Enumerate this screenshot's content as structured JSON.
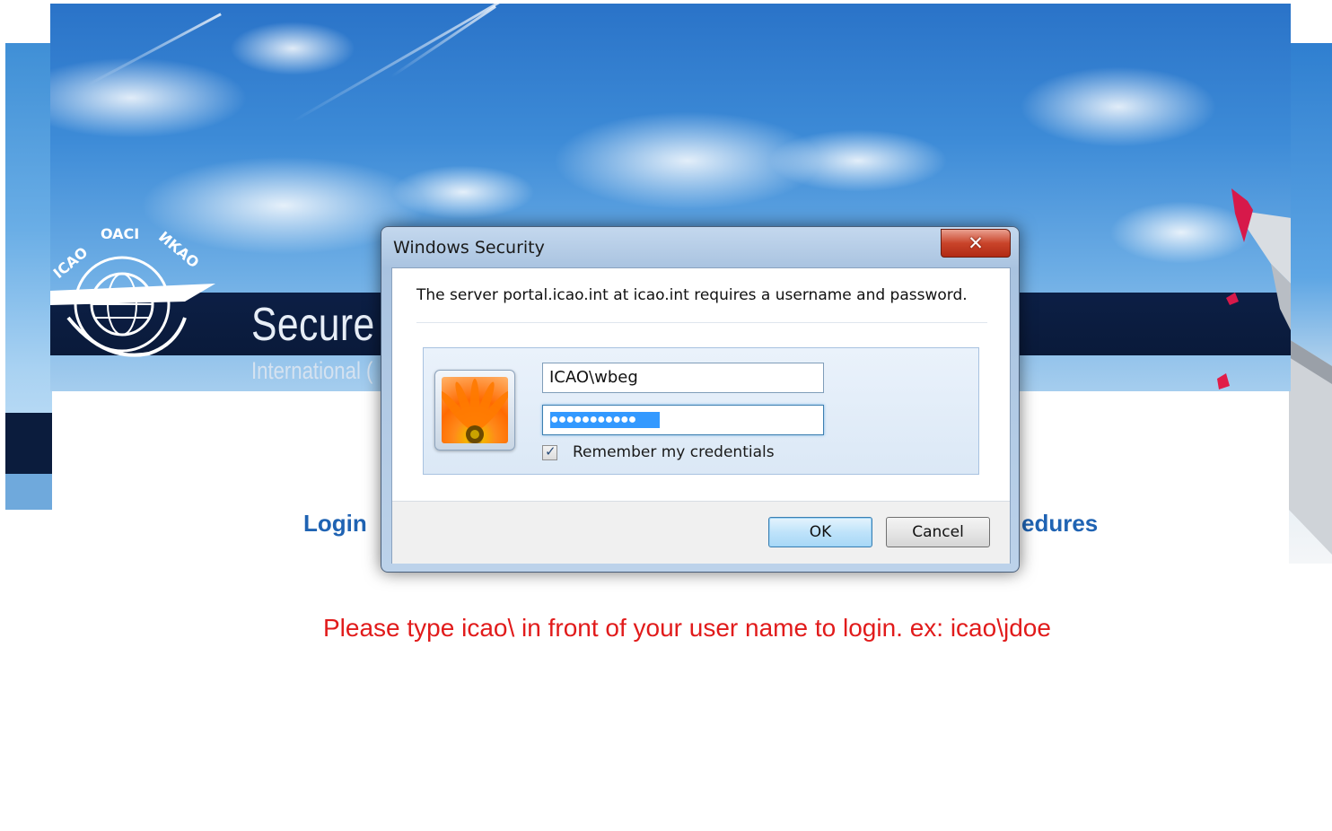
{
  "page": {
    "hero_title": "Secure",
    "hero_subtitle": "International (",
    "nav_login": "Login",
    "nav_procedures": "edures",
    "notice": "Please type icao\\ in front of your user name to login. ex: icao\\jdoe",
    "logo_text": "ICAO • OACI • ИКАО"
  },
  "dialog": {
    "title": "Windows Security",
    "close_icon": "close-icon",
    "message": "The server portal.icao.int at icao.int requires a username and password.",
    "username_value": "ICAO\\wbeg",
    "password_mask": "●●●●●●●●●●●",
    "remember_label": "Remember my credentials",
    "remember_checked": true,
    "ok_label": "OK",
    "cancel_label": "Cancel"
  },
  "colors": {
    "nav_link": "#1f63b3",
    "notice": "#e11b1b",
    "banner": "#0b1c3d",
    "selection": "#3399ff"
  }
}
